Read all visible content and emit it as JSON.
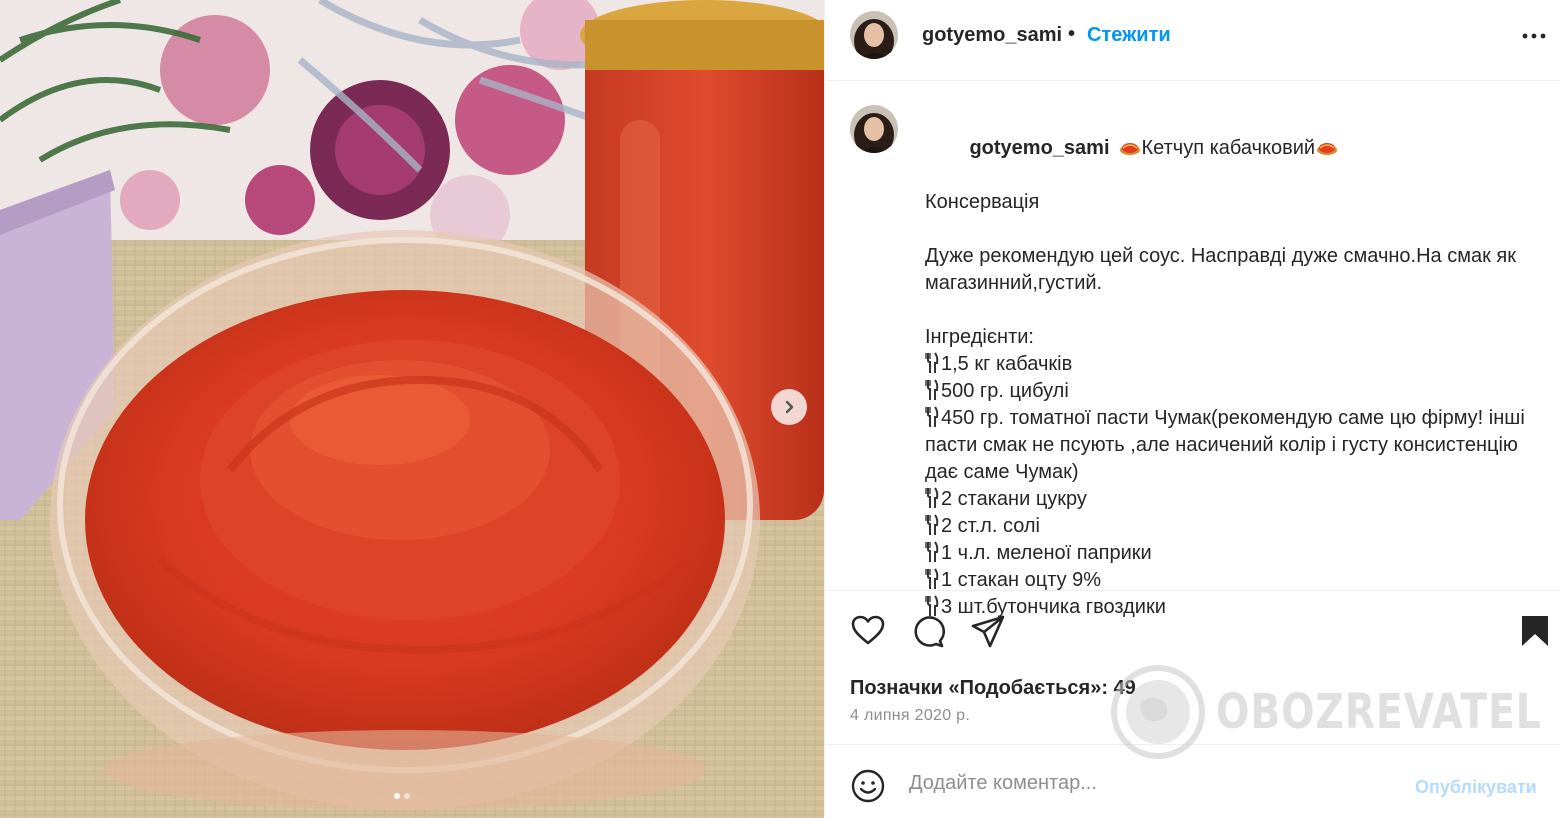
{
  "post": {
    "username": "gotyemo_sami",
    "separator": "•",
    "follow_label": "Стежити",
    "more_icon": "more-icon"
  },
  "caption": {
    "username": "gotyemo_sami",
    "title": "Кетчуп кабачковий",
    "category": "Консервація",
    "intro": "Дуже рекомендую цей соус. Насправді дуже смачно.На смак як магазинний,густий.",
    "ingredients_label": "Інгредієнти:",
    "ingredients": [
      "1,5 кг кабачків",
      "500 гр. цибулі",
      "450 гр. томатної пасти Чумак(рекомендую саме цю фірму! інші пасти смак не псують ,але насичений колір і густу консистенцію дає саме Чумак)",
      "2 стакани цукру",
      "2 ст.л. солі",
      "1 ч.л. меленої паприки",
      "1 стакан оцту 9%",
      "3 шт.бутончика гвоздики"
    ]
  },
  "stats": {
    "likes_label": "Позначки «Подобається»:",
    "likes_count": "49",
    "date": "4 липня 2020 р."
  },
  "comment": {
    "placeholder": "Додайте коментар...",
    "publish_label": "Опублікувати"
  },
  "carousel": {
    "current": 1,
    "total": 2
  },
  "watermark": "OBOZREVATEL",
  "colors": {
    "link": "#0095f6",
    "publish_disabled": "#b3dbff",
    "secondary_text": "#8e8e8e",
    "divider": "#efefef"
  }
}
